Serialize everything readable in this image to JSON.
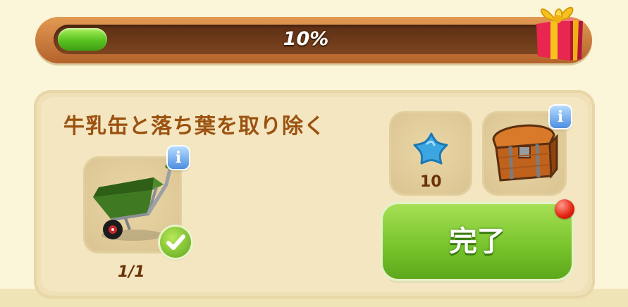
{
  "progress": {
    "percent_label": "10%",
    "fraction": 0.1
  },
  "task": {
    "title": "牛乳缶と落ち葉を取り除く",
    "item_count": "1/1",
    "item_icon": "wheelbarrow-icon"
  },
  "rewards": {
    "star_count": "10",
    "star_icon": "blue-star-icon",
    "chest_icon": "treasure-chest-icon"
  },
  "actions": {
    "done_label": "完了"
  },
  "colors": {
    "title": "#9b5211",
    "progress_fill": "#58c21f",
    "button": "#76c22a",
    "notify": "#e2220f"
  }
}
